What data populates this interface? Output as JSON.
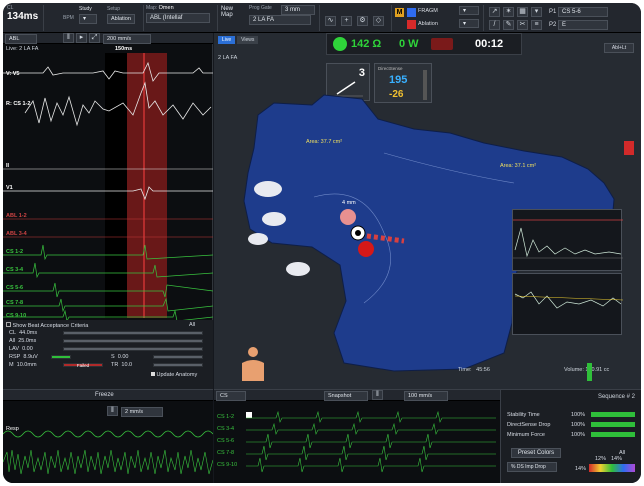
{
  "topbar": {
    "cycle_length": "134ms",
    "bpm_label": "BPM",
    "bpm_value": "447",
    "study_label": "Study",
    "ablation_label": "Ablation",
    "map_label": "Map:",
    "map_value": "Omen",
    "map2_value": "ABL (Intellaf",
    "new_label": "New",
    "map_label2": "Map",
    "prog_label": "Prog Gate",
    "prog_value": "3 mm",
    "current_map": "2 LA FA",
    "frag_label": "FRAGM",
    "ablation_tag": "Ablation",
    "p1_label": "P1",
    "p1_value": "CS 5-6",
    "p2_label": "P2",
    "p2_value": "E"
  },
  "left_panel": {
    "channel_select": "ABL",
    "sweep": "200 mm/s",
    "live_label": "Live: 2 LA FA",
    "window_ms": "150ms",
    "channels": [
      {
        "name": "V: V5",
        "color": "#ffffff"
      },
      {
        "name": "R: CS 1-2",
        "color": "#ffffff"
      },
      {
        "name": "II",
        "color": "#ffffff"
      },
      {
        "name": "V1",
        "color": "#ffffff"
      },
      {
        "name": "ABL 1-2",
        "color": "#c83a3a"
      },
      {
        "name": "ABL 3-4",
        "color": "#c83a3a"
      },
      {
        "name": "CS 1-2",
        "color": "#39c43f"
      },
      {
        "name": "CS 3-4",
        "color": "#39c43f"
      },
      {
        "name": "CS 5-6",
        "color": "#39c43f"
      },
      {
        "name": "CS 7-8",
        "color": "#39c43f"
      },
      {
        "name": "CS 9-10",
        "color": "#39c43f"
      }
    ],
    "criteria": {
      "title": "Show Beat Acceptance Criteria",
      "all_label": "All",
      "cl_label": "CL",
      "cl_value": "44.0ms",
      "all_label2": "All",
      "all_value": "25.0ms",
      "lav_label": "LAV",
      "lav_value": "0.00",
      "rsp_label": "RSP",
      "rsp_value": "8.9uV",
      "s_label": "S",
      "s_value": "0.00",
      "m_label": "M",
      "m_value": "10.0mm",
      "failed_label": "Failed",
      "tr_label": "TR",
      "tr_value": "10.0",
      "update_label": "Update Anatomy"
    }
  },
  "map": {
    "tab_left": "Live",
    "tab_right": "Views",
    "impedance": "142 Ω",
    "power": "0 W",
    "timer": "00:12",
    "label": "2 LA FA",
    "area1": "Area: 37.7 cm²",
    "area2": "Area: 37.1 cm²",
    "catheter_label": "4 mm",
    "time_label": "Time:",
    "time_value": "45:56",
    "volume_label": "Volume:",
    "volume_value": "170.91 cc",
    "force_value": "3",
    "direct_sense_label": "DirectSense",
    "ds_top": "195",
    "ds_bottom": "-26",
    "right_tag": "Abl+Lt"
  },
  "bottom_left": {
    "title": "Freeze",
    "sweep": "2 mm/s",
    "resp_label": "Resp"
  },
  "bottom_mid": {
    "channel": "CS",
    "snapshot_label": "Snapshot",
    "sweep": "100 mm/s",
    "channels": [
      "CS 1-2",
      "CS 3-4",
      "CS 5-6",
      "CS 7-8",
      "CS 9-10"
    ]
  },
  "bottom_right": {
    "sequence": "Sequence # 2",
    "stability_label": "Stability Time",
    "stability_pct": "100%",
    "ds_drop_label": "DirectSense Drop",
    "ds_drop_pct": "100%",
    "min_force_label": "Minimum Force",
    "min_force_pct": "100%",
    "preset_label": "Preset Colors",
    "all_label": "All",
    "imp_drop_label": "% DS Imp Drop",
    "pct_a": "12%",
    "pct_b": "14%",
    "pct_c": "14%"
  }
}
